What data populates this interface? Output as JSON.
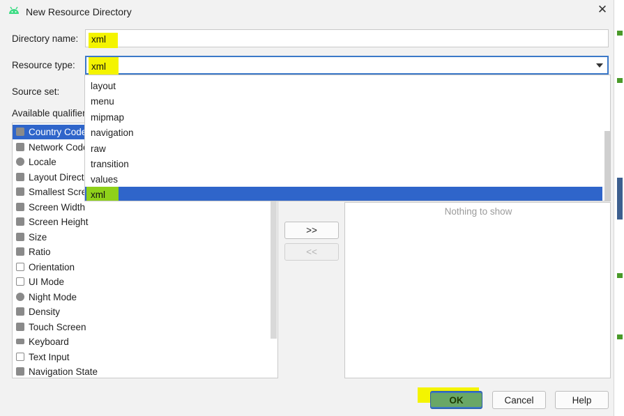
{
  "window": {
    "title": "New Resource Directory"
  },
  "form": {
    "directory_name_label": "Directory name:",
    "directory_name_value": "xml",
    "resource_type_label": "Resource type:",
    "resource_type_value": "xml",
    "source_set_label": "Source set:",
    "available_qualifiers_label": "Available qualifier"
  },
  "qualifiers": [
    {
      "label": "Country Code",
      "icon": "country-code-icon",
      "selected": true
    },
    {
      "label": "Network Code",
      "icon": "network-code-icon"
    },
    {
      "label": "Locale",
      "icon": "globe-icon"
    },
    {
      "label": "Layout Directi",
      "icon": "layout-direction-icon"
    },
    {
      "label": "Smallest Scree",
      "icon": "smallest-screen-icon"
    },
    {
      "label": "Screen Width",
      "icon": "screen-width-icon"
    },
    {
      "label": "Screen Height",
      "icon": "screen-height-icon"
    },
    {
      "label": "Size",
      "icon": "size-icon"
    },
    {
      "label": "Ratio",
      "icon": "ratio-icon"
    },
    {
      "label": "Orientation",
      "icon": "orientation-icon"
    },
    {
      "label": "UI Mode",
      "icon": "ui-mode-icon"
    },
    {
      "label": "Night Mode",
      "icon": "night-mode-icon"
    },
    {
      "label": "Density",
      "icon": "density-icon"
    },
    {
      "label": "Touch Screen",
      "icon": "touch-screen-icon"
    },
    {
      "label": "Keyboard",
      "icon": "keyboard-icon"
    },
    {
      "label": "Text Input",
      "icon": "text-input-icon"
    },
    {
      "label": "Navigation State",
      "icon": "navigation-state-icon"
    }
  ],
  "dropdown": {
    "options": [
      "layout",
      "menu",
      "mipmap",
      "navigation",
      "raw",
      "transition",
      "values",
      "xml"
    ],
    "selected": "xml"
  },
  "chosen": {
    "empty_text": "Nothing to show"
  },
  "buttons": {
    "add": ">>",
    "remove": "<<",
    "ok": "OK",
    "cancel": "Cancel",
    "help": "Help"
  },
  "colors": {
    "selection": "#2f65ca",
    "highlight": "#f4f400",
    "focus": "#3b78c8"
  }
}
